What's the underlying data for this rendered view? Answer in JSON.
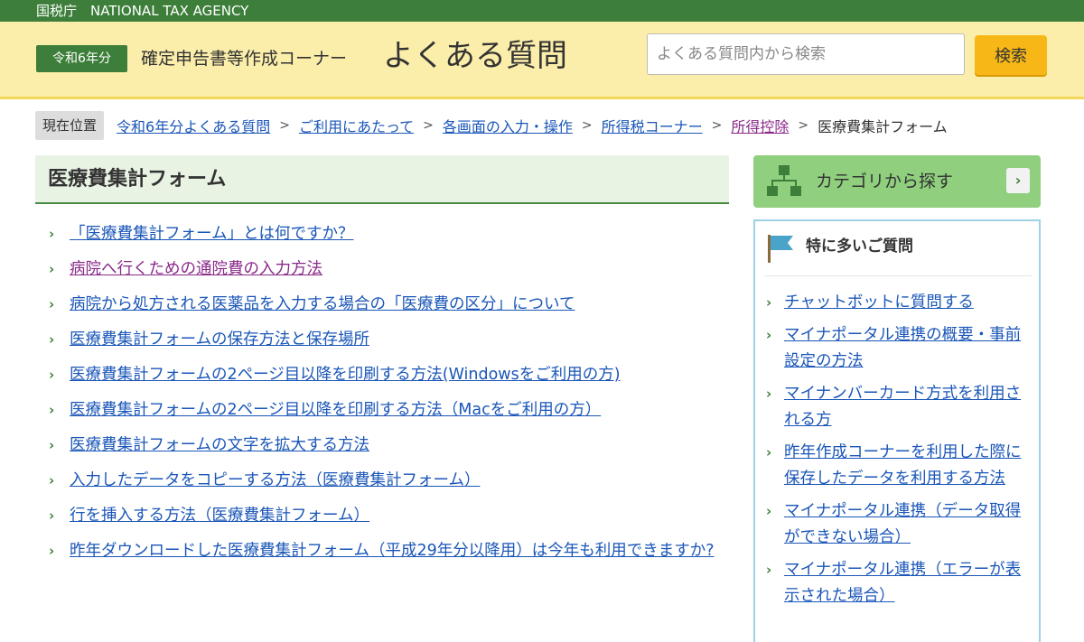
{
  "topbar": {
    "agency": "国税庁　NATIONAL TAX AGENCY"
  },
  "header": {
    "year_badge": "令和6年分",
    "corner_label": "確定申告書等作成コーナー",
    "title": "よくある質問",
    "search_placeholder": "よくある質問内から検索",
    "search_button": "検索"
  },
  "breadcrumb": {
    "label": "現在位置",
    "items": [
      {
        "label": "令和6年分よくある質問"
      },
      {
        "label": "ご利用にあたって"
      },
      {
        "label": "各画面の入力・操作"
      },
      {
        "label": "所得税コーナー"
      },
      {
        "label": "所得控除"
      }
    ],
    "current": "医療費集計フォーム"
  },
  "main": {
    "heading": "医療費集計フォーム",
    "questions": [
      {
        "label": "「医療費集計フォーム」とは何ですか？"
      },
      {
        "label": "病院へ行くための通院費の入力方法"
      },
      {
        "label": "病院から処方される医薬品を入力する場合の「医療費の区分」について"
      },
      {
        "label": "医療費集計フォームの保存方法と保存場所"
      },
      {
        "label": "医療費集計フォームの2ページ目以降を印刷する方法(Windowsをご利用の方)"
      },
      {
        "label": "医療費集計フォームの2ページ目以降を印刷する方法（Macをご利用の方）"
      },
      {
        "label": "医療費集計フォームの文字を拡大する方法"
      },
      {
        "label": "入力したデータをコピーする方法（医療費集計フォーム）"
      },
      {
        "label": "行を挿入する方法（医療費集計フォーム）"
      },
      {
        "label": "昨年ダウンロードした医療費集計フォーム（平成29年分以降用）は今年も利用できますか?"
      }
    ]
  },
  "sidebar": {
    "category_button": "カテゴリから探す",
    "popular_title": "特に多いご質問",
    "popular": [
      {
        "label": "チャットボットに質問する"
      },
      {
        "label": "マイナポータル連携の概要・事前設定の方法"
      },
      {
        "label": "マイナンバーカード方式を利用される方"
      },
      {
        "label": "昨年作成コーナーを利用した際に保存したデータを利用する方法"
      },
      {
        "label": "マイナポータル連携（データ取得ができない場合）"
      },
      {
        "label": "マイナポータル連携（エラーが表示された場合）"
      }
    ]
  },
  "colors": {
    "brand_green": "#3d7f3a",
    "header_yellow": "#fbeeaa",
    "link_blue": "#1a56b8",
    "visited_purple": "#8a2a8a",
    "search_orange": "#f7b817"
  },
  "icons": {
    "chevron": "chevron-right-icon",
    "category": "hierarchy-icon",
    "popular": "flag-icon"
  }
}
